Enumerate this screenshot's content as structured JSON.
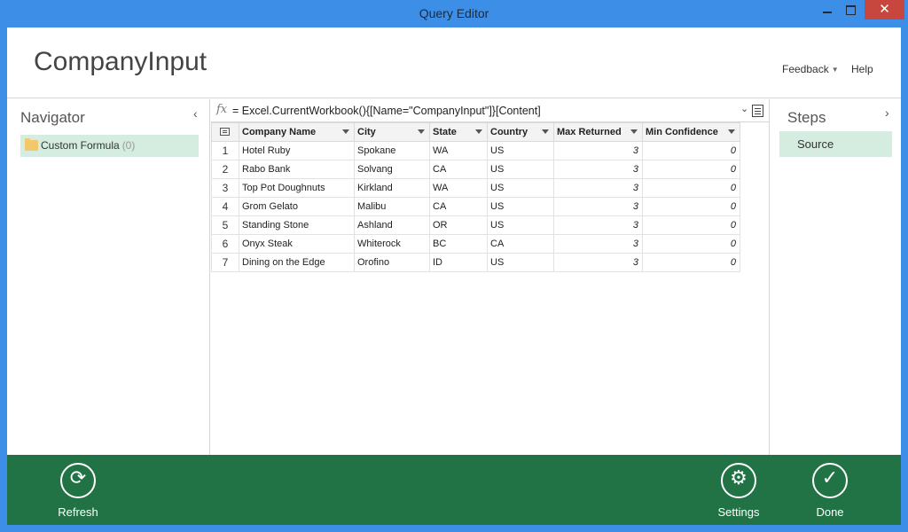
{
  "window": {
    "title": "Query Editor",
    "close_glyph": "✕"
  },
  "header": {
    "title": "CompanyInput",
    "feedback_label": "Feedback",
    "help_label": "Help"
  },
  "navigator": {
    "title": "Navigator",
    "items": [
      {
        "label": "Custom Formula",
        "count": "(0)",
        "icon": "folder-icon"
      }
    ]
  },
  "formula": {
    "fx": "fx",
    "text": "= Excel.CurrentWorkbook(){[Name=\"CompanyInput\"]}[Content]"
  },
  "table": {
    "columns": [
      "Company Name",
      "City",
      "State",
      "Country",
      "Max Returned",
      "Min Confidence"
    ],
    "rows": [
      {
        "n": "1",
        "cells": [
          "Hotel Ruby",
          "Spokane",
          "WA",
          "US",
          "3",
          "0"
        ]
      },
      {
        "n": "2",
        "cells": [
          "Rabo Bank",
          "Solvang",
          "CA",
          "US",
          "3",
          "0"
        ]
      },
      {
        "n": "3",
        "cells": [
          "Top Pot Doughnuts",
          "Kirkland",
          "WA",
          "US",
          "3",
          "0"
        ]
      },
      {
        "n": "4",
        "cells": [
          "Grom Gelato",
          "Malibu",
          "CA",
          "US",
          "3",
          "0"
        ]
      },
      {
        "n": "5",
        "cells": [
          "Standing Stone",
          "Ashland",
          "OR",
          "US",
          "3",
          "0"
        ]
      },
      {
        "n": "6",
        "cells": [
          "Onyx Steak",
          "Whiterock",
          "BC",
          "CA",
          "3",
          "0"
        ]
      },
      {
        "n": "7",
        "cells": [
          "Dining on the Edge",
          "Orofino",
          "ID",
          "US",
          "3",
          "0"
        ]
      }
    ]
  },
  "steps": {
    "title": "Steps",
    "items": [
      {
        "label": "Source"
      }
    ]
  },
  "footer": {
    "refresh_label": "Refresh",
    "settings_label": "Settings",
    "done_label": "Done",
    "accent": "#217346"
  }
}
